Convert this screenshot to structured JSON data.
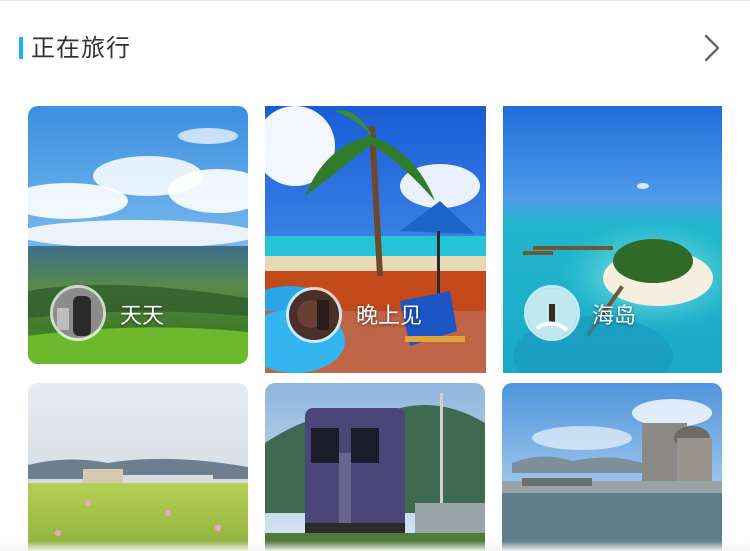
{
  "section": {
    "title": "正在旅行",
    "more_icon": "chevron-right-icon",
    "accent_color": "#1fb2e6"
  },
  "cards": [
    {
      "label": "天天",
      "scene": "grassland-sky"
    },
    {
      "label": "晚上见",
      "scene": "tropical-pool"
    },
    {
      "label": "海岛",
      "scene": "island-aerial"
    },
    {
      "label": "",
      "scene": "flower-field-town"
    },
    {
      "label": "",
      "scene": "purple-train"
    },
    {
      "label": "",
      "scene": "river-city"
    }
  ]
}
